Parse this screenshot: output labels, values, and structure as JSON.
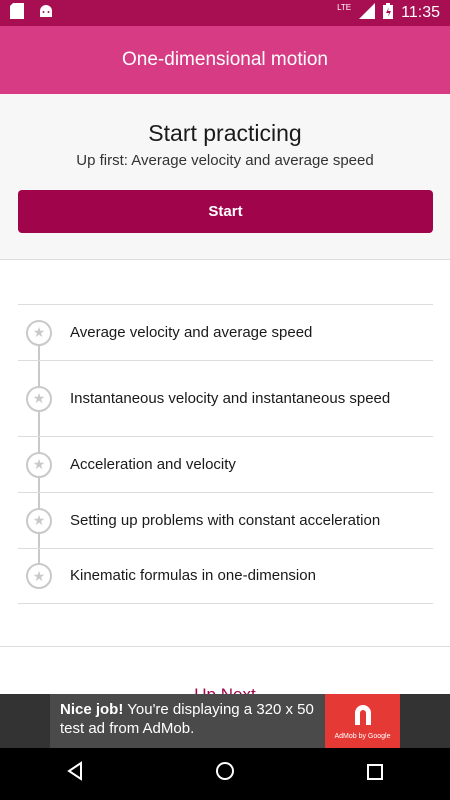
{
  "status_bar": {
    "network": "LTE",
    "time": "11:35",
    "icons": [
      "sd-card-icon",
      "android-icon",
      "signal-icon",
      "battery-charging-icon"
    ]
  },
  "app_bar": {
    "title": "One-dimensional motion"
  },
  "practice": {
    "title": "Start practicing",
    "subtitle": "Up first: Average velocity and average speed",
    "start_label": "Start"
  },
  "skills": [
    {
      "label": "Average velocity and average speed",
      "icon": "star-icon"
    },
    {
      "label": "Instantaneous velocity and instantaneous speed",
      "icon": "star-icon"
    },
    {
      "label": "Acceleration and velocity",
      "icon": "star-icon"
    },
    {
      "label": "Setting up problems with constant acceleration",
      "icon": "star-icon"
    },
    {
      "label": "Kinematic formulas in one-dimension",
      "icon": "star-icon"
    }
  ],
  "up_next": {
    "label": "Up Next"
  },
  "ad": {
    "headline": "Nice job!",
    "body": "You're displaying a 320 x 50 test ad from AdMob.",
    "caption": "AdMob by Google"
  },
  "nav": {
    "back": "back-icon",
    "home": "home-icon",
    "recents": "recents-icon"
  },
  "colors": {
    "status_bar": "#a80f53",
    "app_bar": "#d73b83",
    "accent": "#a0054c"
  }
}
